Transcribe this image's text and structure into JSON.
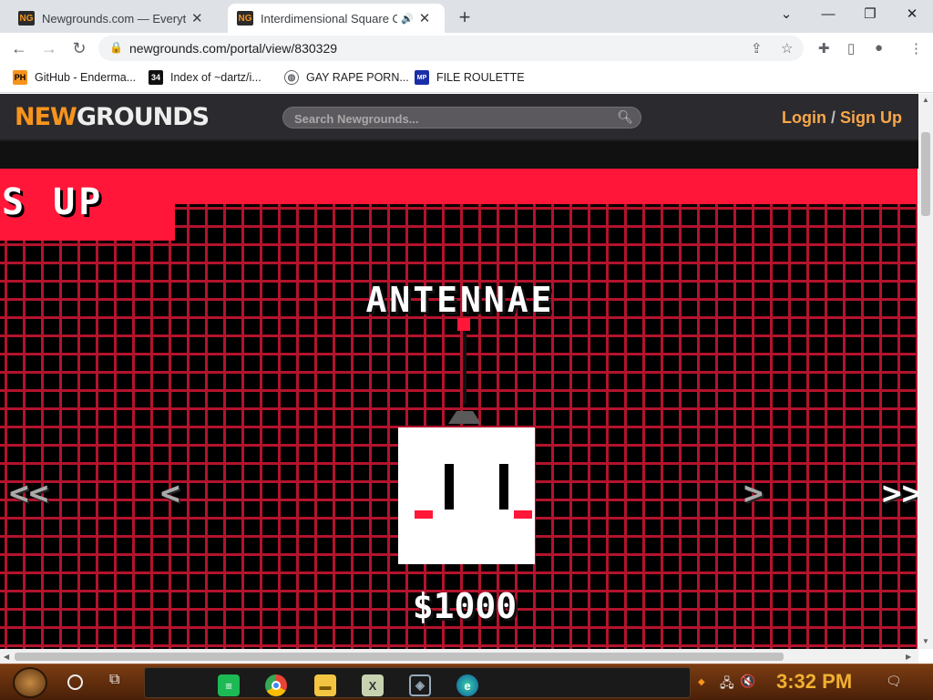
{
  "browser": {
    "tabs": [
      {
        "title": "Newgrounds.com — Everything",
        "active": false
      },
      {
        "title": "Interdimensional Square O",
        "active": true
      }
    ],
    "new_tab_label": "+",
    "url": "newgrounds.com/portal/view/830329",
    "bookmarks": [
      {
        "label": "GitHub - Enderma...",
        "icon_text": "PH"
      },
      {
        "label": "Index of ~dartz/i...",
        "icon_text": "34"
      },
      {
        "label": "GAY RAPE PORN...",
        "icon_text": ""
      },
      {
        "label": "FILE ROULETTE",
        "icon_text": "MP"
      }
    ]
  },
  "site": {
    "logo_part1": "NEW",
    "logo_part2": "GROUNDS",
    "search_placeholder": "Search Newgrounds...",
    "login_label": "Login",
    "login_sep": "/",
    "signup_label": "Sign Up"
  },
  "game": {
    "banner_text": "S UP",
    "item_name": "ANTENNAE",
    "price": "$1000",
    "arrow_first": "<<",
    "arrow_prev": "<",
    "arrow_next": ">",
    "arrow_last": ">>"
  },
  "taskbar": {
    "time": "3:32 PM"
  },
  "colors": {
    "ng_orange": "#f7941d",
    "game_red": "#ff1638",
    "grid_red": "#b3132c",
    "clock_gold": "#f0b030"
  }
}
